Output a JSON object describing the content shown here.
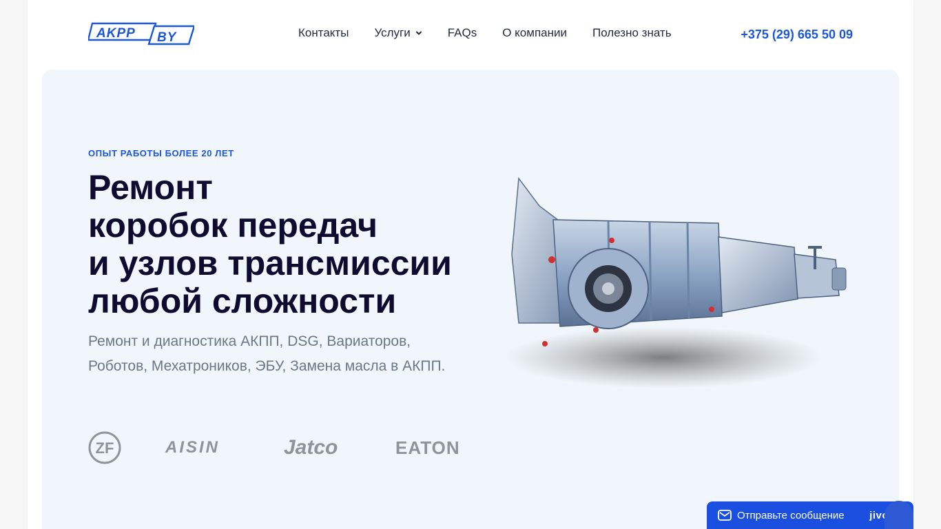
{
  "header": {
    "logo_text": "AKPP BY",
    "nav": [
      {
        "label": "Контакты"
      },
      {
        "label": "Услуги",
        "has_dropdown": true
      },
      {
        "label": "FAQs"
      },
      {
        "label": "О компании"
      },
      {
        "label": "Полезно знать"
      }
    ],
    "phone": "+375 (29) 665 50 09"
  },
  "hero": {
    "eyebrow": "ОПЫТ РАБОТЫ БОЛЕЕ 20 ЛЕТ",
    "title_lines": [
      "Ремонт",
      "коробок передач",
      "и узлов трансмиссии",
      "любой сложности"
    ],
    "subtitle_lines": [
      "Ремонт и диагностика АКПП, DSG, Вариаторов,",
      "Роботов, Мехатроников, ЭБУ, Замена масла в АКПП."
    ],
    "brands": [
      "ZF",
      "AISIN",
      "Jatco",
      "EATON"
    ],
    "image": "gearbox-transmission"
  },
  "chat": {
    "label": "Отправьте сообщение",
    "brand": "jivo"
  },
  "colors": {
    "accent": "#1a56db",
    "hero_bg": "#f0f6fb",
    "heading": "#0f0a30",
    "muted": "#6b7788",
    "chat_bg": "#1a4fe0"
  }
}
